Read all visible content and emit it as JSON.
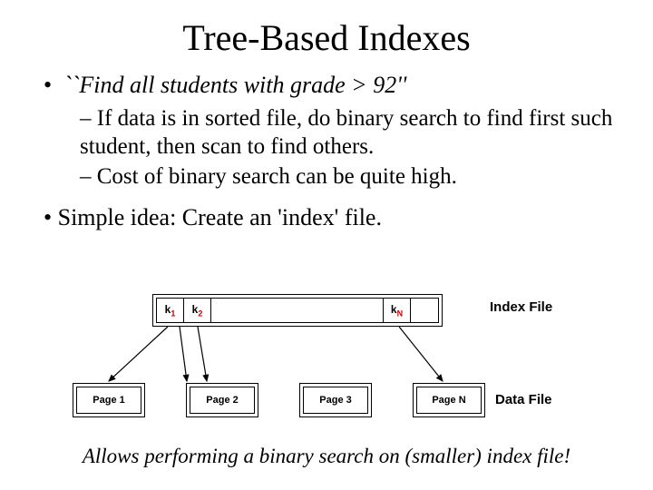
{
  "title": "Tree-Based Indexes",
  "bullet1": "``Find all students with grade > 92''",
  "sub1": "– If data is in sorted file, do binary search to find first such student, then scan to find others.",
  "sub2": "– Cost of binary search can be quite high.",
  "bullet2": "•  Simple idea:  Create an 'index' file.",
  "index": {
    "k1": "k",
    "k1s": "1",
    "k2": "k",
    "k2s": "2",
    "kn": "k",
    "kns": "N"
  },
  "labels": {
    "index_file": "Index File",
    "data_file": "Data File"
  },
  "pages": {
    "p1": "Page 1",
    "p2": "Page 2",
    "p3": "Page 3",
    "pn": "Page N"
  },
  "footer": "Allows performing a binary search on (smaller) index file!"
}
